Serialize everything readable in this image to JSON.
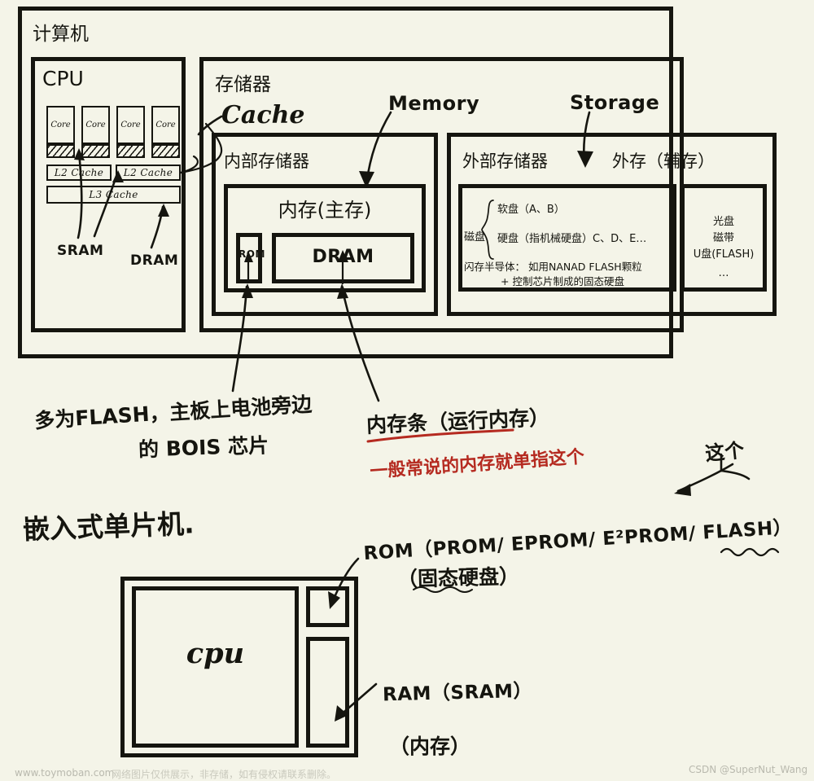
{
  "diagram": {
    "title": "计算机",
    "computer_box_label": "计算机",
    "cpu": {
      "title": "CPU",
      "cores": [
        "Core",
        "Core",
        "Core",
        "Core"
      ],
      "l2_caches": [
        "L2 Cache",
        "L2 Cache"
      ],
      "l3_cache": "L3 Cache",
      "annotations": {
        "sram": "SRAM",
        "dram": "DRAM"
      }
    },
    "memory_unit": {
      "title": "存储器",
      "hand_label_cache": "Cache",
      "hand_label_memory": "Memory",
      "hand_label_storage": "Storage"
    },
    "internal_storage": {
      "title": "内部存储器",
      "main_memory": {
        "title": "内存(主存)",
        "rom": "ROM",
        "dram": "DRAM"
      }
    },
    "external_storage": {
      "title": "外部存储器",
      "alias": "外存（辅存）",
      "disk_label": "磁盘",
      "disk_items": [
        "软盘（A、B）",
        "硬盘（指机械硬盘）C、D、E…"
      ],
      "flash_line1": "闪存半导体： 如用NANAD FLASH颗粒",
      "flash_line2": "+ 控制芯片制成的固态硬盘",
      "right_items": [
        "光盘",
        "磁带",
        "U盘(FLASH)",
        "…"
      ]
    },
    "notes": {
      "rom_note_line1": "多为FLASH，主板上电池旁边",
      "rom_note_line2": "的 BOIS 芯片",
      "dram_note": "内存条（运行内存）",
      "dram_note_red": "一般常说的内存就单指这个",
      "mcu_title": "嵌入式单片机.",
      "pointer_word": "这个"
    },
    "mcu": {
      "cpu_label": "cpu",
      "rom_label_line1": "ROM（PROM/ EPROM/ E²PROM/ FLASH）",
      "rom_label_line2": "（固态硬盘）",
      "ram_label_line1": "RAM（SRAM）",
      "ram_label_line2": "（内存）"
    }
  },
  "watermarks": {
    "left_url": "www.toymoban.com",
    "left_notice": "网络图片仅供展示，非存储，如有侵权请联系删除。",
    "right": "CSDN @SuperNut_Wang"
  },
  "colors": {
    "background": "#f4f4e8",
    "ink": "#15150f",
    "red_ink": "#b52a20"
  }
}
